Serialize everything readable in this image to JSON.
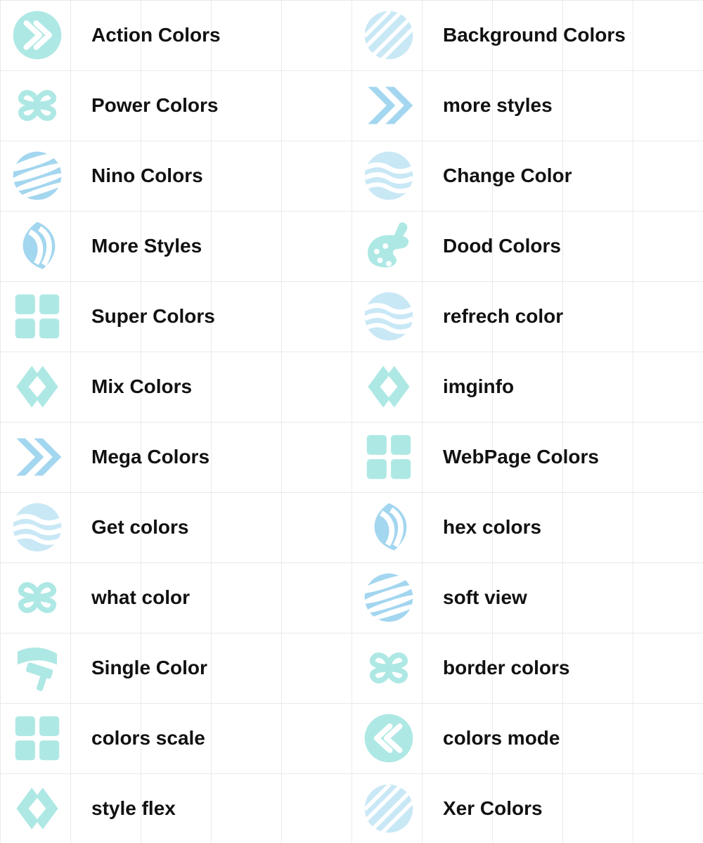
{
  "columns": [
    [
      {
        "label": "Action Colors",
        "icon": "circle-arrows-right",
        "color": "#aee8e4"
      },
      {
        "label": "Power Colors",
        "icon": "clover",
        "color": "#aee8e4"
      },
      {
        "label": "Nino Colors",
        "icon": "swirl-ball",
        "color": "#a3d6ef"
      },
      {
        "label": "More Styles",
        "icon": "wave-leaf",
        "color": "#a3d6ef"
      },
      {
        "label": "Super Colors",
        "icon": "four-squares",
        "color": "#aee8e4"
      },
      {
        "label": "Mix Colors",
        "icon": "diamond-brackets",
        "color": "#aee8e4"
      },
      {
        "label": "Mega Colors",
        "icon": "double-chevron-right",
        "color": "#a3d6ef"
      },
      {
        "label": "Get colors",
        "icon": "wave-ball",
        "color": "#c9e8f6"
      },
      {
        "label": "what color",
        "icon": "clover",
        "color": "#aee8e4"
      },
      {
        "label": "Single Color",
        "icon": "paint-roller",
        "color": "#aee8e4"
      },
      {
        "label": "colors scale",
        "icon": "four-squares",
        "color": "#aee8e4"
      },
      {
        "label": "style flex",
        "icon": "diamond-brackets",
        "color": "#aee8e4"
      }
    ],
    [
      {
        "label": "Background Colors",
        "icon": "hatched-circle",
        "color": "#c9e8f6"
      },
      {
        "label": "more styles",
        "icon": "double-chevron-right",
        "color": "#a3d6ef"
      },
      {
        "label": "Change Color",
        "icon": "wave-ball",
        "color": "#c9e8f6"
      },
      {
        "label": "Dood Colors",
        "icon": "palette",
        "color": "#aee8e4"
      },
      {
        "label": "refrech color",
        "icon": "wave-ball",
        "color": "#c9e8f6"
      },
      {
        "label": "imginfo",
        "icon": "diamond-brackets",
        "color": "#aee8e4"
      },
      {
        "label": "WebPage Colors",
        "icon": "four-squares",
        "color": "#aee8e4"
      },
      {
        "label": "hex colors",
        "icon": "wave-leaf",
        "color": "#a3d6ef"
      },
      {
        "label": "soft view",
        "icon": "swirl-ball",
        "color": "#a3d6ef"
      },
      {
        "label": "border colors",
        "icon": "clover",
        "color": "#aee8e4"
      },
      {
        "label": "colors mode",
        "icon": "circle-arrows-left",
        "color": "#aee8e4"
      },
      {
        "label": "Xer Colors",
        "icon": "hatched-circle",
        "color": "#c9e8f6"
      }
    ]
  ]
}
